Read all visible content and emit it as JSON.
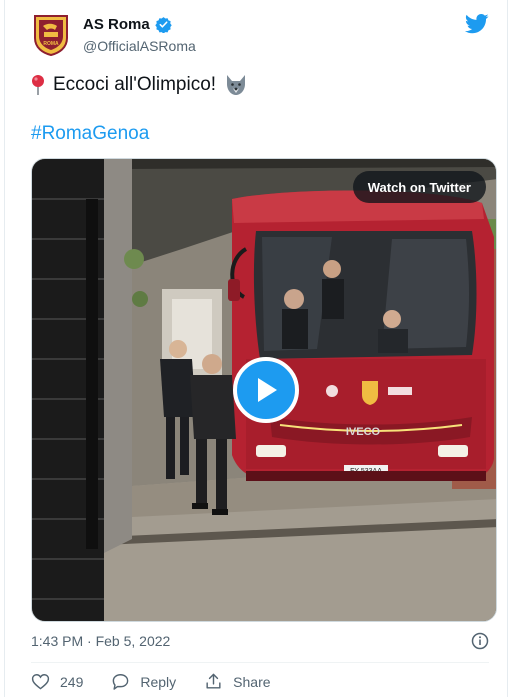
{
  "account": {
    "name": "AS Roma",
    "handle": "@OfficialASRoma",
    "logo_text": "ROMA"
  },
  "tweet": {
    "text": "Eccoci all'Olimpico!",
    "hashtag": "#RomaGenoa"
  },
  "media": {
    "watch_label": "Watch on Twitter",
    "bus_brand": "IVECO",
    "plate": "FY 533AA"
  },
  "meta": {
    "timestamp": "1:43 PM · Feb 5, 2022"
  },
  "actions": {
    "like_count": "249",
    "reply_label": "Reply",
    "share_label": "Share"
  },
  "colors": {
    "accent": "#1d9bf0",
    "roma_red": "#8e1f2f",
    "roma_gold": "#f0bc42"
  }
}
